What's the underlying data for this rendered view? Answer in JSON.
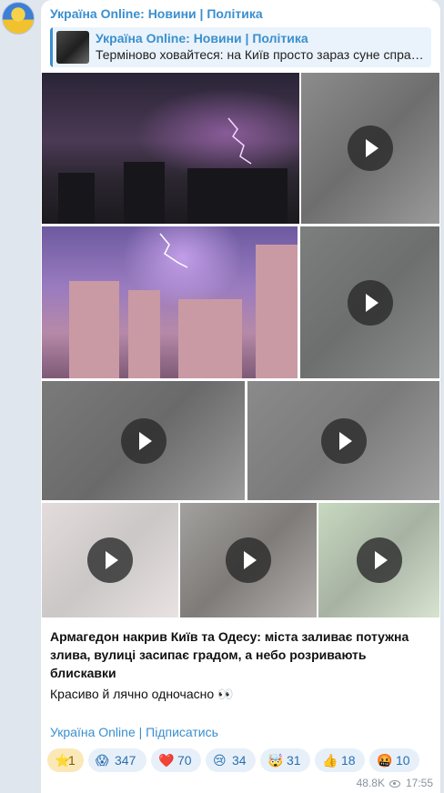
{
  "channel": {
    "title": "Україна Online: Новини | Політика"
  },
  "reply": {
    "title": "Україна Online: Новини | Політика",
    "text": "Терміново ховайтеся: на Київ просто зараз суне спра…"
  },
  "message": {
    "headline": "Армагедон накрив Київ та Одесу: міста заливає потужна злива, вулиці засипає градом, а небо розривають блискавки",
    "body": "Красиво й лячно одночасно 👀",
    "subscribe_link": "Україна Online | Підписатись"
  },
  "media": {
    "items": [
      {
        "type": "photo",
        "icon": "photo-lightning-night"
      },
      {
        "type": "video",
        "icon": "play-icon"
      },
      {
        "type": "photo",
        "icon": "photo-lightning-purple"
      },
      {
        "type": "video",
        "icon": "play-icon"
      },
      {
        "type": "video",
        "icon": "play-icon"
      },
      {
        "type": "video",
        "icon": "play-icon"
      },
      {
        "type": "video",
        "icon": "play-icon"
      },
      {
        "type": "video",
        "icon": "play-icon"
      },
      {
        "type": "video",
        "icon": "play-icon"
      }
    ]
  },
  "reactions": [
    {
      "icon": "⭐",
      "count": "1"
    },
    {
      "icon": "😱",
      "count": "347"
    },
    {
      "icon": "❤️",
      "count": "70"
    },
    {
      "icon": "😢",
      "count": "34"
    },
    {
      "icon": "🤯",
      "count": "31"
    },
    {
      "icon": "👍",
      "count": "18"
    },
    {
      "icon": "🤬",
      "count": "10"
    }
  ],
  "meta": {
    "views": "48.8K",
    "time": "17:55"
  },
  "colors": {
    "accent": "#3a8fcf",
    "background": "#dfe6ee",
    "bubble": "#ffffff"
  }
}
